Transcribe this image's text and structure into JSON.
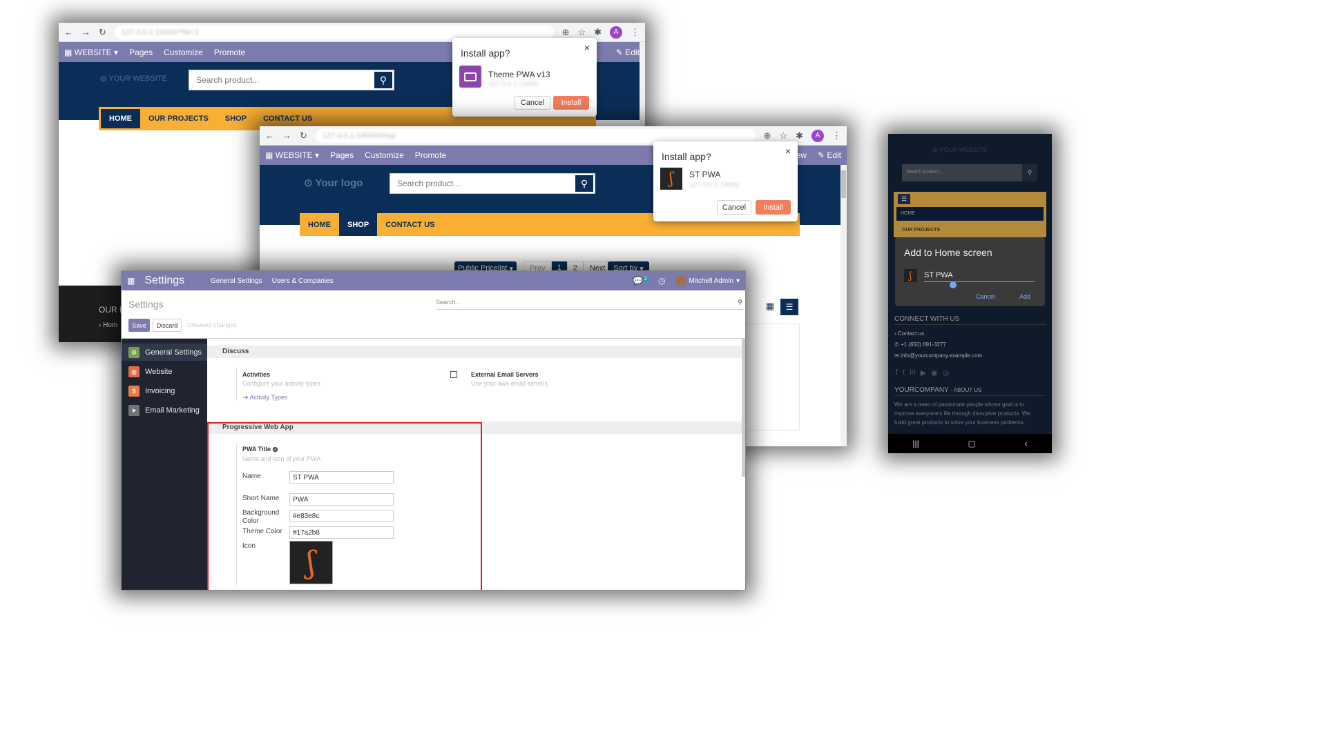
{
  "shot1": {
    "url": "127.0.0.1:13000/?fw=1",
    "avatar": "A",
    "topnav": {
      "website": "WEBSITE",
      "pages": "Pages",
      "customize": "Customize",
      "promote": "Promote",
      "edit": "Edit"
    },
    "logo": "YOUR WEBSITE",
    "search_placeholder": "Search product...",
    "menu": [
      "HOME",
      "OUR PROJECTS",
      "SHOP",
      "CONTACT US"
    ],
    "footer_heading": "OUR P",
    "footer_link": "Hom",
    "dialog": {
      "title": "Install app?",
      "name": "Theme PWA v13",
      "url": "127.0.0.1:13000",
      "cancel": "Cancel",
      "install": "Install"
    }
  },
  "shot2": {
    "url": "127.0.0.1:14000/shop",
    "avatar": "A",
    "topnav": {
      "website": "WEBSITE",
      "pages": "Pages",
      "customize": "Customize",
      "promote": "Promote",
      "view": "ew",
      "edit": "Edit"
    },
    "logo": "Your logo",
    "search_placeholder": "Search product...",
    "menu": [
      "HOME",
      "SHOP",
      "CONTACT US"
    ],
    "pricelist": "Public Pricelist",
    "pager": [
      "Prev",
      "1",
      "2",
      "Next"
    ],
    "sort": "Sort by",
    "dialog": {
      "title": "Install app?",
      "name": "ST PWA",
      "url": "127.0.0.1:14000",
      "cancel": "Cancel",
      "install": "Install"
    }
  },
  "settings": {
    "app_title": "Settings",
    "tabs": [
      "General Settings",
      "Users & Companies"
    ],
    "chat_count": "2",
    "user": "Mitchell Admin",
    "breadcrumb": "Settings",
    "search_placeholder": "Search...",
    "save": "Save",
    "discard": "Discard",
    "unsaved": "Unsaved changes",
    "sidebar": [
      {
        "label": "General Settings",
        "color": "#7ca04a"
      },
      {
        "label": "Website",
        "color": "#e16d4c"
      },
      {
        "label": "Invoicing",
        "color": "#e77e4a"
      },
      {
        "label": "Email Marketing",
        "color": "#6f7479"
      }
    ],
    "discuss": {
      "heading": "Discuss",
      "activities": "Activities",
      "activities_desc": "Configure your activity types",
      "activity_types": "Activity Types",
      "ext_email": "External Email Servers",
      "ext_email_desc": "Use your own email servers"
    },
    "pwa": {
      "heading": "Progressive Web App",
      "title": "PWA Title",
      "desc": "Name and icon of your PWA",
      "name_label": "Name",
      "name_value": "ST PWA",
      "short_label": "Short Name",
      "short_value": "PWA",
      "bg_label_1": "Background",
      "bg_label_2": "Color",
      "bg_value": "#e83e8c",
      "theme_label": "Theme Color",
      "theme_value": "#17a2b8",
      "icon_label": "Icon"
    }
  },
  "phone": {
    "logo": "YOUR WEBSITE",
    "search_placeholder": "Search product...",
    "menu": [
      "HOME",
      "OUR PROJECTS"
    ],
    "dialog": {
      "title": "Add to Home screen",
      "name": "ST PWA",
      "cancel": "Cancel",
      "add": "Add"
    },
    "connect": "CONNECT WITH US",
    "contact": "Contact us",
    "phone": "+1 (650) 691-3277",
    "email": "info@yourcompany.example.com",
    "company": "YOURCOMPANY",
    "about": "- ABOUT US",
    "about_text_1": "We are a team of passionate people whose goal is to",
    "about_text_2": "improve everyone's life through disruptive products. We",
    "about_text_3": "build great products to solve your business problems."
  }
}
